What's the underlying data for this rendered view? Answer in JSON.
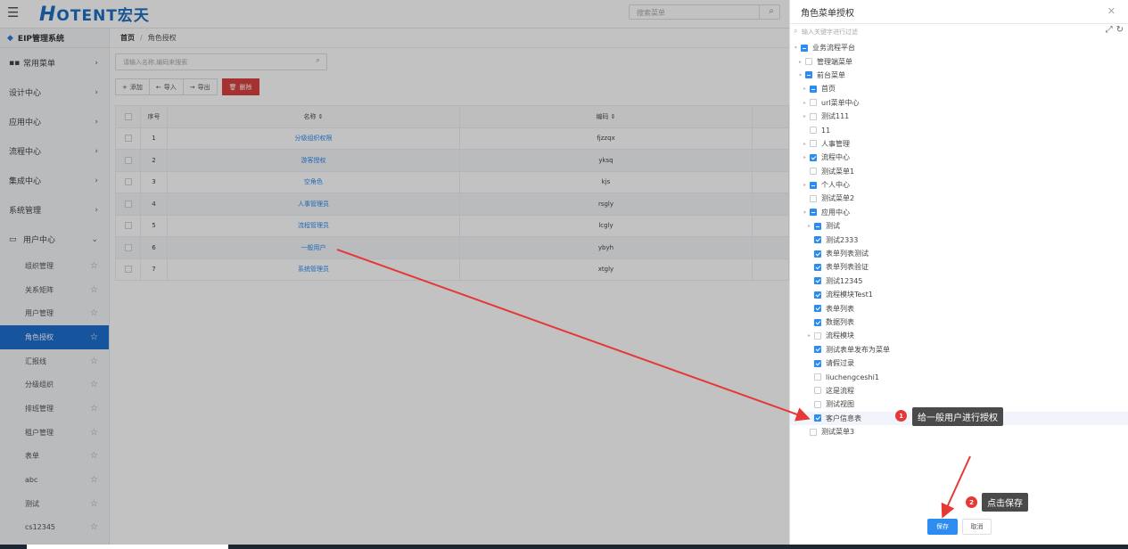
{
  "header": {
    "menu_icon": "hamburger-icon",
    "logo_big": "H",
    "logo_rest": "OTENT宏天",
    "search_placeholder": "搜索菜单"
  },
  "sidebar": {
    "title": "EIP管理系统",
    "top_items": [
      {
        "label": "常用菜单"
      },
      {
        "label": "设计中心"
      },
      {
        "label": "应用中心"
      },
      {
        "label": "流程中心"
      },
      {
        "label": "集成中心"
      },
      {
        "label": "系统管理"
      },
      {
        "label": "用户中心"
      }
    ],
    "sub_items": [
      {
        "label": "组织管理"
      },
      {
        "label": "关系矩阵"
      },
      {
        "label": "用户管理"
      },
      {
        "label": "角色授权"
      },
      {
        "label": "汇报线"
      },
      {
        "label": "分级组织"
      },
      {
        "label": "排班管理"
      },
      {
        "label": "租户管理"
      },
      {
        "label": "表单"
      },
      {
        "label": "abc"
      },
      {
        "label": "测试"
      },
      {
        "label": "cs12345"
      }
    ]
  },
  "main": {
    "breadcrumb_home": "首页",
    "breadcrumb_current": "角色授权",
    "search_placeholder": "请输入名称,编码来搜索",
    "toolbar": {
      "add": "添加",
      "import": "导入",
      "export": "导出",
      "delete": "删除"
    },
    "table": {
      "headers": [
        "序号",
        "名称 ⇕",
        "编码 ⇕"
      ],
      "rows": [
        {
          "no": "1",
          "name": "分级组织权限",
          "code": "fjzzqx"
        },
        {
          "no": "2",
          "name": "游客授权",
          "code": "yksq"
        },
        {
          "no": "3",
          "name": "空角色",
          "code": "kjs"
        },
        {
          "no": "4",
          "name": "人事管理员",
          "code": "rsgly"
        },
        {
          "no": "5",
          "name": "流程管理员",
          "code": "lcgly"
        },
        {
          "no": "6",
          "name": "一般用户",
          "code": "ybyh"
        },
        {
          "no": "7",
          "name": "系统管理员",
          "code": "xtgly"
        }
      ]
    }
  },
  "dialog": {
    "title": "角色菜单授权",
    "filter_placeholder": "输入关键字进行过滤",
    "tree": [
      {
        "label": "业务流程平台",
        "level": 0,
        "state": "half",
        "arrow": "down"
      },
      {
        "label": "管理端菜单",
        "level": 1,
        "state": "none",
        "arrow": "right"
      },
      {
        "label": "前台菜单",
        "level": 1,
        "state": "half",
        "arrow": "down"
      },
      {
        "label": "首页",
        "level": 2,
        "state": "half",
        "arrow": "right"
      },
      {
        "label": "url菜单中心",
        "level": 2,
        "state": "none",
        "arrow": "right"
      },
      {
        "label": "测试111",
        "level": 2,
        "state": "none",
        "arrow": "right"
      },
      {
        "label": "11",
        "level": 2,
        "state": "none",
        "arrow": ""
      },
      {
        "label": "人事管理",
        "level": 2,
        "state": "none",
        "arrow": "right"
      },
      {
        "label": "流程中心",
        "level": 2,
        "state": "checked",
        "arrow": "right"
      },
      {
        "label": "测试菜单1",
        "level": 2,
        "state": "none",
        "arrow": ""
      },
      {
        "label": "个人中心",
        "level": 2,
        "state": "half",
        "arrow": "right"
      },
      {
        "label": "测试菜单2",
        "level": 2,
        "state": "none",
        "arrow": ""
      },
      {
        "label": "应用中心",
        "level": 2,
        "state": "half",
        "arrow": "down"
      },
      {
        "label": "测试",
        "level": 3,
        "state": "half",
        "arrow": "right"
      },
      {
        "label": "测试2333",
        "level": 3,
        "state": "checked",
        "arrow": ""
      },
      {
        "label": "表单列表测试",
        "level": 3,
        "state": "checked",
        "arrow": ""
      },
      {
        "label": "表单列表验证",
        "level": 3,
        "state": "checked",
        "arrow": ""
      },
      {
        "label": "测试12345",
        "level": 3,
        "state": "checked",
        "arrow": ""
      },
      {
        "label": "流程模块Test1",
        "level": 3,
        "state": "checked",
        "arrow": ""
      },
      {
        "label": "表单列表",
        "level": 3,
        "state": "checked",
        "arrow": ""
      },
      {
        "label": "数据列表",
        "level": 3,
        "state": "checked",
        "arrow": ""
      },
      {
        "label": "流程模块",
        "level": 3,
        "state": "none",
        "arrow": "right"
      },
      {
        "label": "测试表单发布为菜单",
        "level": 3,
        "state": "checked",
        "arrow": ""
      },
      {
        "label": "请假过录",
        "level": 3,
        "state": "checked",
        "arrow": ""
      },
      {
        "label": "liuchengceshi1",
        "level": 3,
        "state": "none",
        "arrow": ""
      },
      {
        "label": "这是流程",
        "level": 3,
        "state": "none",
        "arrow": ""
      },
      {
        "label": "测试视图",
        "level": 3,
        "state": "none",
        "arrow": ""
      },
      {
        "label": "客户信息表",
        "level": 3,
        "state": "checked",
        "arrow": "",
        "highlight": true
      },
      {
        "label": "测试菜单3",
        "level": 2,
        "state": "none",
        "arrow": ""
      }
    ],
    "save": "保存",
    "cancel": "取消"
  },
  "annotations": [
    {
      "number": "1",
      "text": "给一般用户进行授权"
    },
    {
      "number": "2",
      "text": "点击保存"
    }
  ],
  "colors": {
    "primary": "#2d8cf0",
    "sidebar_active": "#1f6fd0",
    "danger": "#d94141",
    "annotation_red": "#e53935"
  }
}
